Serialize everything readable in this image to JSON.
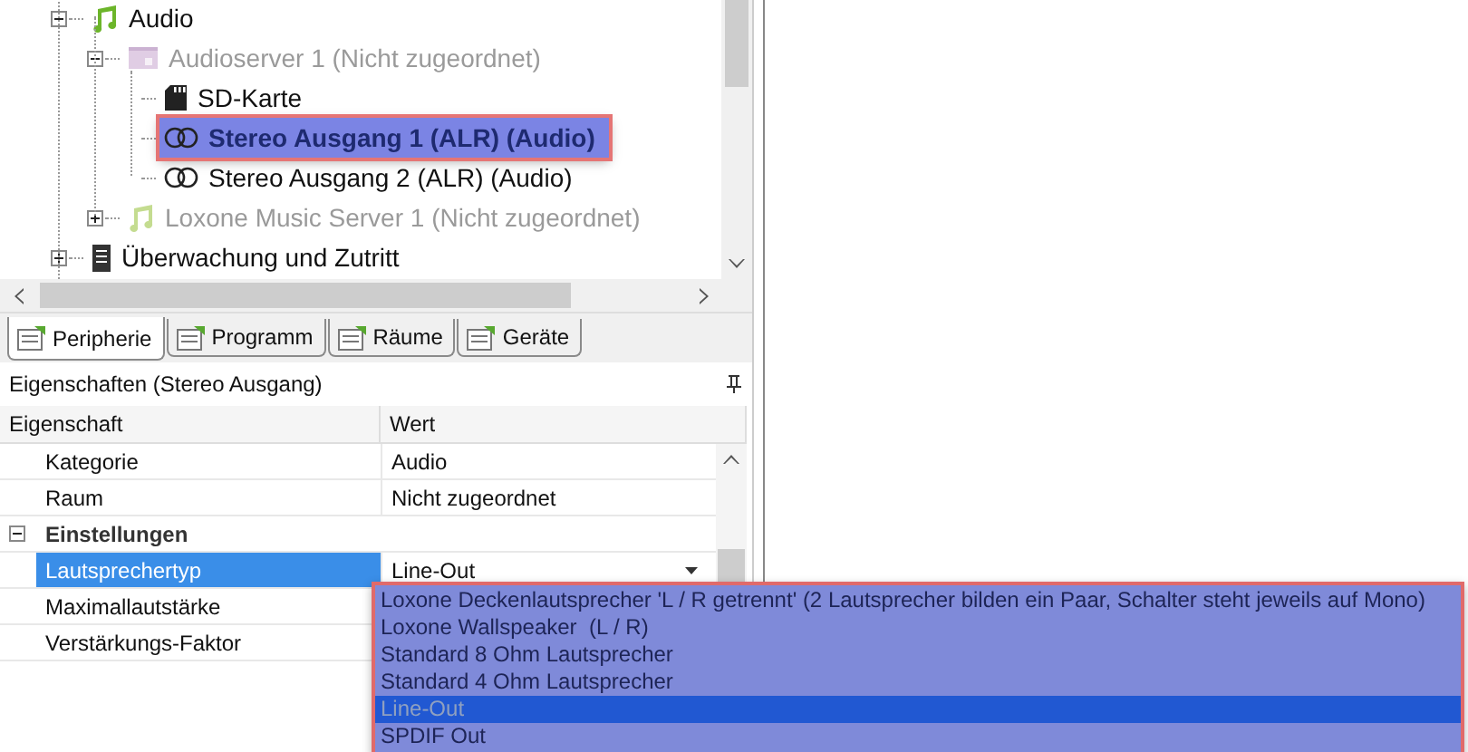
{
  "tree": {
    "items": [
      {
        "label": "Audio",
        "kind": "music",
        "disabled": false,
        "selected": false,
        "expanded": true,
        "children": [
          {
            "label": "Audioserver 1 (Nicht zugeordnet)",
            "kind": "server",
            "disabled": true,
            "selected": false,
            "expanded": true,
            "children": [
              {
                "label": "SD-Karte",
                "kind": "sdcard",
                "disabled": false,
                "selected": false
              },
              {
                "label": "Stereo Ausgang 1 (ALR) (Audio)",
                "kind": "stereo",
                "disabled": false,
                "selected": true
              },
              {
                "label": "Stereo Ausgang 2 (ALR) (Audio)",
                "kind": "stereo",
                "disabled": false,
                "selected": false
              }
            ]
          },
          {
            "label": "Loxone Music Server 1 (Nicht zugeordnet)",
            "kind": "music",
            "disabled": true,
            "selected": false,
            "expanded": false
          }
        ]
      },
      {
        "label": "Überwachung und Zutritt",
        "kind": "device",
        "disabled": false,
        "selected": false,
        "expanded": false
      }
    ]
  },
  "tabs": [
    {
      "label": "Peripherie",
      "selected": true
    },
    {
      "label": "Programm",
      "selected": false
    },
    {
      "label": "Räume",
      "selected": false
    },
    {
      "label": "Geräte",
      "selected": false
    }
  ],
  "properties": {
    "title": "Eigenschaften (Stereo Ausgang)",
    "columns": [
      "Eigenschaft",
      "Wert"
    ],
    "rows": [
      {
        "kind": "row",
        "name": "Kategorie",
        "value": "Audio",
        "selected": false
      },
      {
        "kind": "row",
        "name": "Raum",
        "value": "Nicht zugeordnet",
        "selected": false
      },
      {
        "kind": "group",
        "name": "Einstellungen",
        "expanded": true
      },
      {
        "kind": "dropdown",
        "name": "Lautsprechertyp",
        "value": "Line-Out",
        "selected": true
      },
      {
        "kind": "row",
        "name": "Maximallautstärke",
        "selected": false
      },
      {
        "kind": "row",
        "name": "Verstärkungs-Faktor",
        "selected": false
      }
    ]
  },
  "dropdown": {
    "options": [
      {
        "label": "Loxone Deckenlautsprecher 'L / R getrennt' (2 Lautsprecher bilden ein Paar, Schalter steht jeweils auf Mono)",
        "selected": false
      },
      {
        "label": "Loxone Wallspeaker  (L / R)",
        "selected": false
      },
      {
        "label": "Standard 8 Ohm Lautsprecher",
        "selected": false
      },
      {
        "label": "Standard 4 Ohm Lautsprecher",
        "selected": false
      },
      {
        "label": "Line-Out",
        "selected": true
      },
      {
        "label": "SPDIF Out",
        "selected": false
      }
    ]
  }
}
